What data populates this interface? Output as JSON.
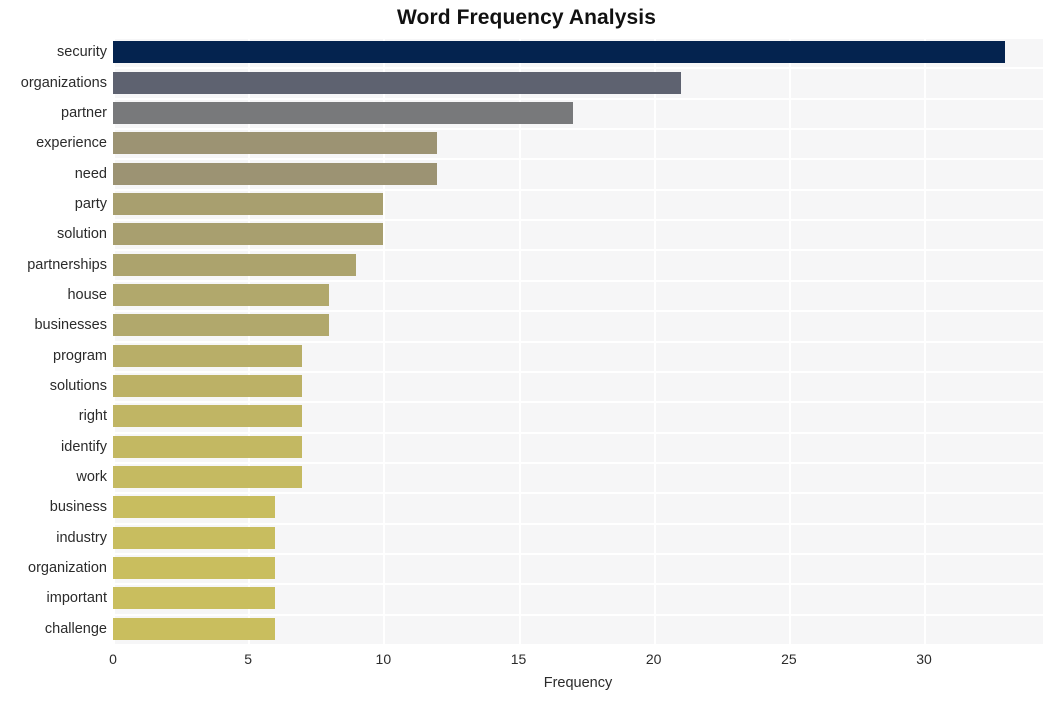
{
  "chart_data": {
    "type": "bar",
    "orientation": "horizontal",
    "title": "Word Frequency Analysis",
    "xlabel": "Frequency",
    "ylabel": "",
    "xlim": [
      0,
      34.4
    ],
    "ylim": null,
    "grid": true,
    "legend": false,
    "xticks": [
      "0",
      "5",
      "10",
      "15",
      "20",
      "25",
      "30"
    ],
    "xtick_values": [
      0,
      5,
      10,
      15,
      20,
      25,
      30
    ],
    "categories": [
      "security",
      "organizations",
      "partner",
      "experience",
      "need",
      "party",
      "solution",
      "partnerships",
      "house",
      "businesses",
      "program",
      "solutions",
      "right",
      "identify",
      "work",
      "business",
      "industry",
      "organization",
      "important",
      "challenge"
    ],
    "values": [
      33,
      21,
      17,
      12,
      12,
      10,
      10,
      9,
      8,
      8,
      7,
      7,
      7,
      7,
      7,
      6,
      6,
      6,
      6,
      6
    ],
    "bar_colors": [
      "#04234f",
      "#5e6270",
      "#78797b",
      "#9c9373",
      "#9c9373",
      "#a89f6f",
      "#a89f6f",
      "#aca36d",
      "#b1a86c",
      "#b1a86c",
      "#b8ae68",
      "#bcb166",
      "#c0b564",
      "#c3b862",
      "#c5ba61",
      "#c8bd5f",
      "#c8bd5f",
      "#c9be5e",
      "#c9be5e",
      "#c9be5e"
    ],
    "plot_background": "#f6f6f7",
    "gridline_color": "#ffffff",
    "figure_background": "#ffffff"
  }
}
